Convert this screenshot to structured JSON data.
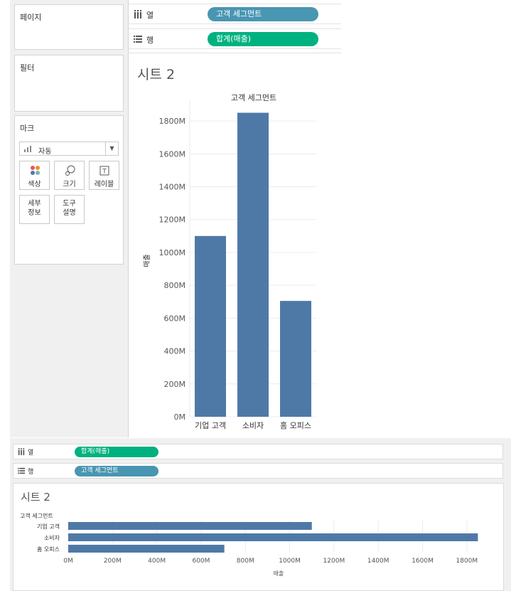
{
  "top": {
    "panels": {
      "pages": "페이지",
      "filters": "필터",
      "marks": "마크"
    },
    "marks_card": {
      "type_selected": "자동",
      "buttons": {
        "color": "색상",
        "size": "크기",
        "label": "레이블",
        "detail": [
          "세부",
          "정보"
        ],
        "tooltip": [
          "도구",
          "설명"
        ]
      }
    },
    "columns_shelf": {
      "label": "열",
      "pill": "고객 세그먼트"
    },
    "rows_shelf": {
      "label": "행",
      "pill": "합계(매출)"
    },
    "sheet_title": "시트 2"
  },
  "bottom": {
    "columns_shelf": {
      "label": "열",
      "pill": "합계(매출)"
    },
    "rows_shelf": {
      "label": "행",
      "pill": "고객 세그먼트"
    },
    "sheet_title": "시트 2"
  },
  "colors": {
    "bar": "#4e79a7",
    "dimension_pill": "#4996b2",
    "measure_pill": "#00b180"
  },
  "chart_data": [
    {
      "type": "bar",
      "orientation": "vertical",
      "title": "고객 세그먼트",
      "categories": [
        "기업 고객",
        "소비자",
        "홈 오피스"
      ],
      "values": [
        1100,
        1850,
        705
      ],
      "ylabel": "매출",
      "unit_suffix": "M",
      "ylim": [
        0,
        1900
      ],
      "yticks": [
        0,
        200,
        400,
        600,
        800,
        1000,
        1200,
        1400,
        1600,
        1800
      ],
      "grid": true
    },
    {
      "type": "bar",
      "orientation": "horizontal",
      "title": "고객 세그먼트",
      "categories": [
        "기업 고객",
        "소비자",
        "홈 오피스"
      ],
      "values": [
        1100,
        1850,
        705
      ],
      "xlabel": "매출",
      "unit_suffix": "M",
      "xlim": [
        0,
        1900
      ],
      "xticks": [
        0,
        200,
        400,
        600,
        800,
        1000,
        1200,
        1400,
        1600,
        1800
      ],
      "grid": true
    }
  ]
}
